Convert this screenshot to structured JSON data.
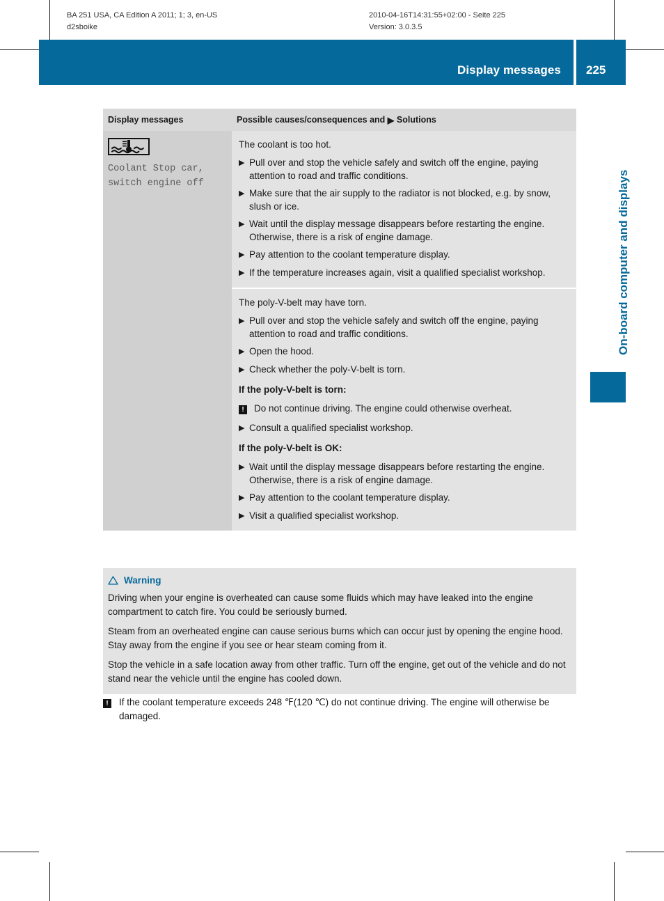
{
  "running_head": {
    "left_line1": "BA 251 USA, CA Edition A 2011; 1; 3, en-US",
    "left_line2": "d2sboike",
    "right_line1": "2010-04-16T14:31:55+02:00 - Seite 225",
    "right_line2": "Version: 3.0.3.5"
  },
  "header": {
    "title": "Display messages",
    "page_number": "225",
    "accent_color": "#06699b"
  },
  "side_tab": {
    "label": "On-board computer and displays"
  },
  "table": {
    "columns": {
      "col1": "Display messages",
      "col2_before": "Possible causes/consequences and",
      "col2_triangle": "▶",
      "col2_after": "Solutions"
    },
    "message": {
      "icon_name": "coolant-temperature-icon",
      "line1": "Coolant Stop car,",
      "line2": "switch engine off"
    },
    "causes": [
      {
        "lead": "The coolant is too hot.",
        "items": [
          {
            "type": "step",
            "text": "Pull over and stop the vehicle safely and switch off the engine, paying attention to road and traffic conditions."
          },
          {
            "type": "step",
            "text": "Make sure that the air supply to the radiator is not blocked, e.g. by snow, slush or ice."
          },
          {
            "type": "step",
            "text": "Wait until the display message disappears before restarting the engine. Otherwise, there is a risk of engine damage."
          },
          {
            "type": "step",
            "text": "Pay attention to the coolant temperature display."
          },
          {
            "type": "step",
            "text": "If the temperature increases again, visit a qualified specialist workshop."
          }
        ]
      },
      {
        "lead": "The poly-V-belt may have torn.",
        "items": [
          {
            "type": "step",
            "text": "Pull over and stop the vehicle safely and switch off the engine, paying attention to road and traffic conditions."
          },
          {
            "type": "step",
            "text": "Open the hood."
          },
          {
            "type": "step",
            "text": "Check whether the poly-V-belt is torn."
          },
          {
            "type": "subhead",
            "text": "If the poly-V-belt is torn:"
          },
          {
            "type": "notice",
            "text": "Do not continue driving. The engine could otherwise overheat."
          },
          {
            "type": "step",
            "text": "Consult a qualified specialist workshop."
          },
          {
            "type": "subhead",
            "text": "If the poly-V-belt is OK:"
          },
          {
            "type": "step",
            "text": "Wait until the display message disappears before restarting the engine. Otherwise, there is a risk of engine damage."
          },
          {
            "type": "step",
            "text": "Pay attention to the coolant temperature display."
          },
          {
            "type": "step",
            "text": "Visit a qualified specialist workshop."
          }
        ]
      }
    ]
  },
  "warning_box": {
    "label": "Warning",
    "icon_name": "warning-triangle-icon",
    "paragraphs": [
      "Driving when your engine is overheated can cause some fluids which may have leaked into the engine compartment to catch fire. You could be seriously burned.",
      "Steam from an overheated engine can cause serious burns which can occur just by opening the engine hood. Stay away from the engine if you see or hear steam coming from it.",
      "Stop the vehicle in a safe location away from other traffic. Turn off the engine, get out of the vehicle and do not stand near the vehicle until the engine has cooled down."
    ]
  },
  "bottom_notice": {
    "icon_name": "notice-exclamation-icon",
    "bang": "!",
    "text": "If the coolant temperature exceeds 248 ℉(120 ℃) do not continue driving. The engine will otherwise be damaged."
  },
  "glyphs": {
    "bullet_triangle": "▶",
    "bang": "!"
  }
}
